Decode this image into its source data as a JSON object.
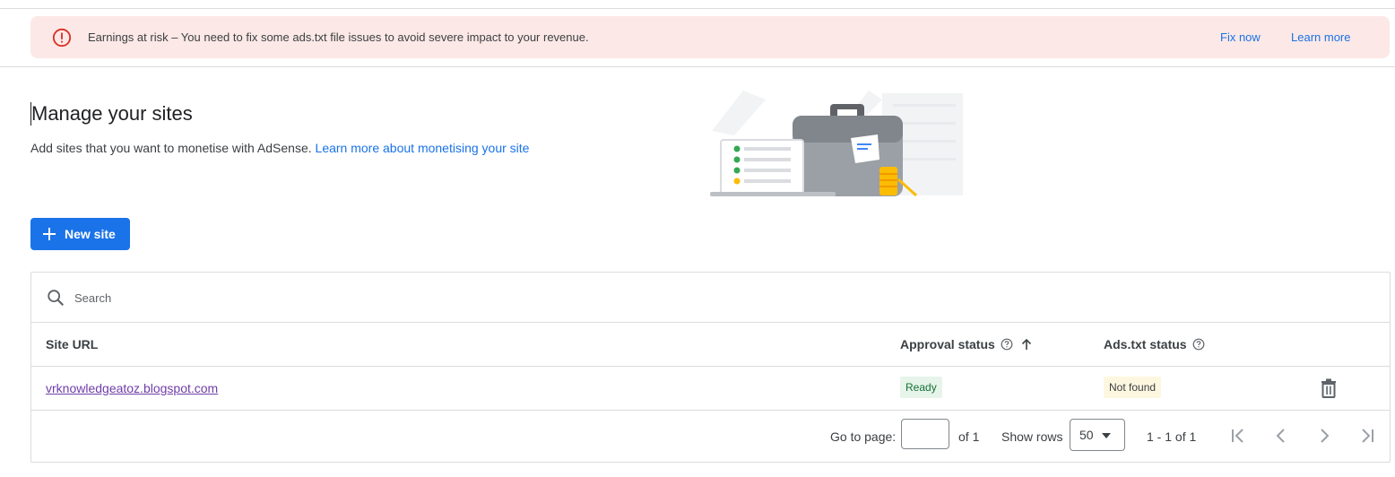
{
  "banner": {
    "message": "Earnings at risk – You need to fix some ads.txt file issues to avoid severe impact to your revenue.",
    "fix_now": "Fix now",
    "learn_more": "Learn more",
    "icon": "error-icon"
  },
  "header": {
    "title": "Manage your sites",
    "subtitle": "Add sites that you want to monetise with AdSense.",
    "subtitle_link": "Learn more about monetising your site"
  },
  "actions": {
    "new_site": "New site"
  },
  "search": {
    "placeholder": "Search",
    "value": ""
  },
  "table": {
    "columns": {
      "site_url": "Site URL",
      "approval_status": "Approval status",
      "ads_txt_status": "Ads.txt status"
    },
    "rows": [
      {
        "site_url": "vrknowledgeatoz.blogspot.com",
        "approval_status": "Ready",
        "ads_txt_status": "Not found"
      }
    ]
  },
  "pagination": {
    "go_to_page_label": "Go to page:",
    "page_value": "",
    "of_pages": "of 1",
    "show_rows_label": "Show rows",
    "rows_per_page": "50",
    "range": "1 - 1 of 1"
  },
  "colors": {
    "accent": "#1a73e8",
    "banner_bg": "#fce8e6",
    "error": "#d93025",
    "ready_bg": "#e6f4ea",
    "ready_text": "#137333",
    "not_found_bg": "#fef7e0"
  }
}
